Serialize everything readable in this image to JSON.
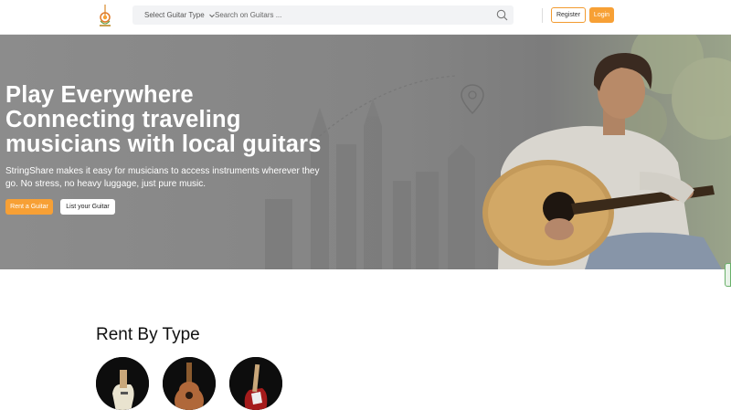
{
  "header": {
    "select_label": "Select Guitar Type",
    "search_placeholder": "Search on Guitars ...",
    "register_label": "Register",
    "login_label": "Login"
  },
  "hero": {
    "title_lines": [
      "Play Everywhere",
      "Connecting traveling",
      "musicians with local guitars"
    ],
    "subtitle": "StringShare makes it easy for musicians to access instruments wherever they go. No stress, no heavy luggage, just pure music.",
    "rent_button": "Rent a Guitar",
    "list_button": "List your Guitar"
  },
  "rent_by_type": {
    "title": "Rent By Type"
  },
  "colors": {
    "accent": "#f7a035",
    "hero_overlay": "#8a8a8a"
  }
}
